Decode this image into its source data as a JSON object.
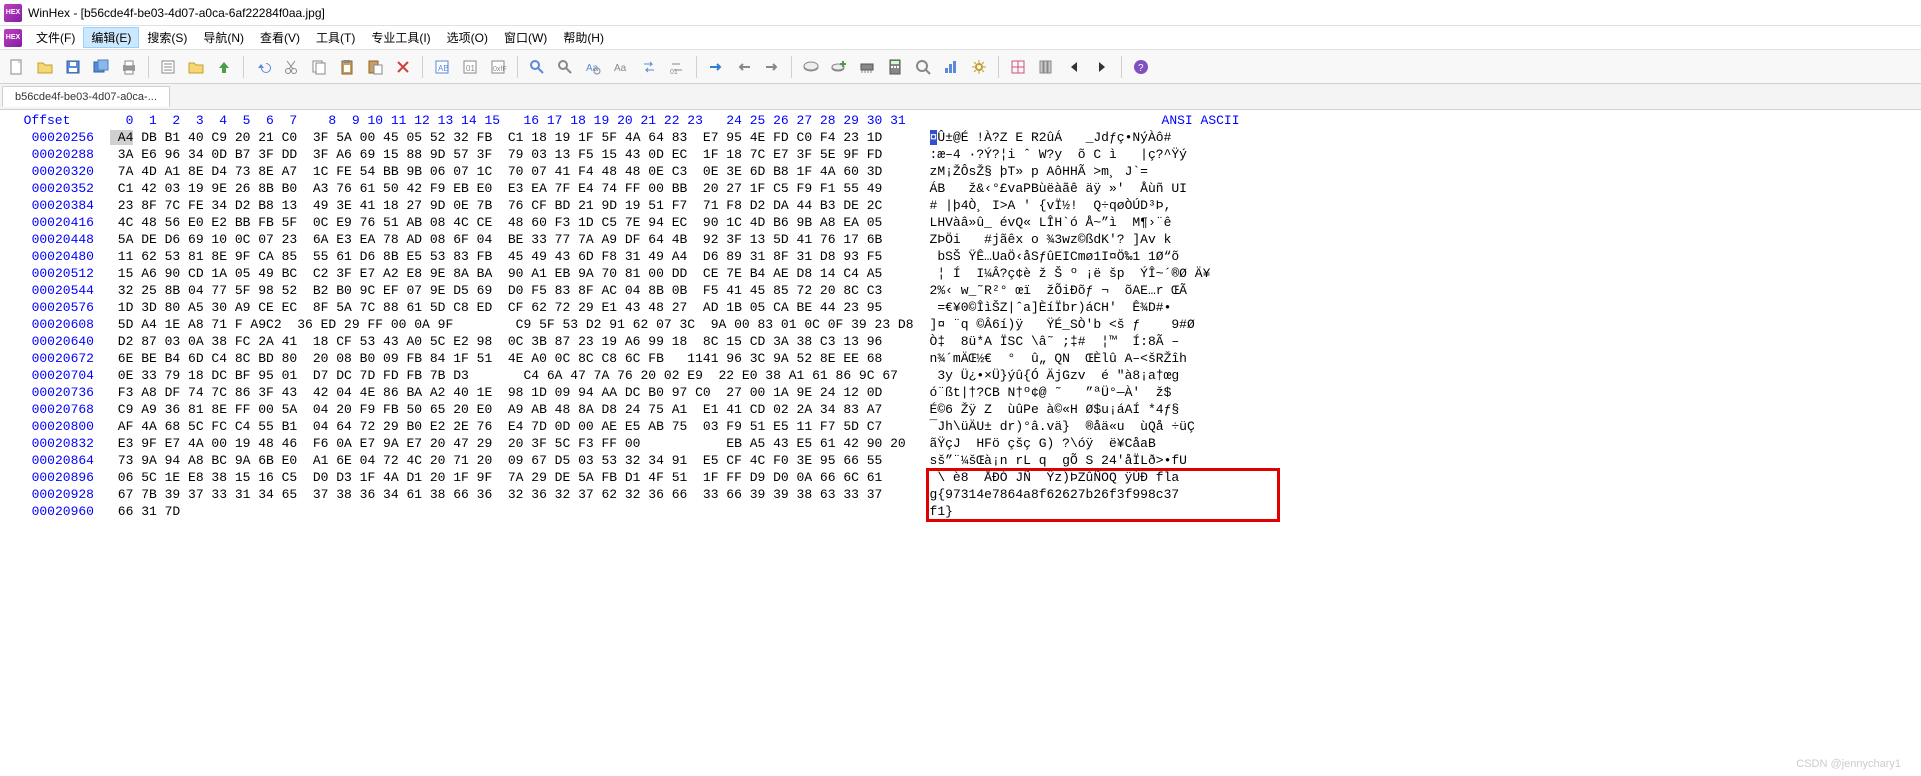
{
  "app": {
    "title": "WinHex - [b56cde4f-be03-4d07-a0ca-6af22284f0aa.jpg]",
    "icon_text": "HEX"
  },
  "menu": {
    "items": [
      {
        "label": "文件(F)"
      },
      {
        "label": "编辑(E)",
        "active": true
      },
      {
        "label": "搜索(S)"
      },
      {
        "label": "导航(N)"
      },
      {
        "label": "查看(V)"
      },
      {
        "label": "工具(T)"
      },
      {
        "label": "专业工具(I)"
      },
      {
        "label": "选项(O)"
      },
      {
        "label": "窗口(W)"
      },
      {
        "label": "帮助(H)"
      }
    ]
  },
  "tab": {
    "label": "b56cde4f-be03-4d07-a0ca-..."
  },
  "hex": {
    "offset_header": "Offset",
    "col_headers": [
      "0",
      "1",
      "2",
      "3",
      "4",
      "5",
      "6",
      "7",
      "8",
      "9",
      "10",
      "11",
      "12",
      "13",
      "14",
      "15",
      "16",
      "17",
      "18",
      "19",
      "20",
      "21",
      "22",
      "23",
      "24",
      "25",
      "26",
      "27",
      "28",
      "29",
      "30",
      "31"
    ],
    "ascii_header": "ANSI ASCII",
    "rows": [
      {
        "offset": "00020256",
        "bytes": "A4 DB B1 40 C9 20 21 C0  3F 5A 00 45 05 52 32 FB  C1 18 19 1F 5F 4A 64 83  E7 95 4E FD C0 F4 23 1D",
        "ascii": "¤Û±@É !À?Z E R2ûÁ   _Jdƒç•NýÀô#"
      },
      {
        "offset": "00020288",
        "bytes": "3A E6 96 34 0D B7 3F DD  3F A6 69 15 88 9D 57 3F  79 03 13 F5 15 43 0D EC  1F 18 7C E7 3F 5E 9F FD",
        "ascii": ":æ–4 ·?Ý?¦i ˆ W?y  õ C ì   |ç?^Ÿý"
      },
      {
        "offset": "00020320",
        "bytes": "7A 4D A1 8E D4 73 8E A7  1C FE 54 BB 9B 06 07 1C  70 07 41 F4 48 48 0E C3  0E 3E 6D B8 1F 4A 60 3D",
        "ascii": "zM¡ŽÔsŽ§ þT» p AôHHÃ >m¸ J`="
      },
      {
        "offset": "00020352",
        "bytes": "C1 42 03 19 9E 26 8B B0  A3 76 61 50 42 F9 EB E0  E3 EA 7F E4 74 FF 00 BB  20 27 1F C5 F9 F1 55 49",
        "ascii": "ÁB   ž&‹°£vaPBùëàãê äÿ »'  Åùñ UI"
      },
      {
        "offset": "00020384",
        "bytes": "23 8F 7C FE 34 D2 B8 13  49 3E 41 18 27 9D 0E 7B  76 CF BD 21 9D 19 51 F7  71 F8 D2 DA 44 B3 DE 2C",
        "ascii": "# |þ4Ò¸ I>A ' {vÏ½!  Q÷qøÒÚD³Þ,"
      },
      {
        "offset": "00020416",
        "bytes": "4C 48 56 E0 E2 BB FB 5F  0C E9 76 51 AB 08 4C CE  48 60 F3 1D C5 7E 94 EC  90 1C 4D B6 9B A8 EA 05",
        "ascii": "LHVàâ»û_ évQ« LÎH`ó Å~”ì  M¶›¨ê"
      },
      {
        "offset": "00020448",
        "bytes": "5A DE D6 69 10 0C 07 23  6A E3 EA 78 AD 08 6F 04  BE 33 77 7A A9 DF 64 4B  92 3F 13 5D 41 76 17 6B",
        "ascii": "ZÞÖi   #jãêx­ o ¾3wz©ßdK'? ]Av k"
      },
      {
        "offset": "00020480",
        "bytes": "11 62 53 81 8E 9F CA 85  55 61 D6 8B E5 53 83 FB  45 49 43 6D F8 31 49 A4  D6 89 31 8F 31 D8 93 F5",
        "ascii": " bSŠ ŸÊ…UaÖ‹åSƒûEICmø1I¤Ö‰1 1Ø“õ"
      },
      {
        "offset": "00020512",
        "bytes": "15 A6 90 CD 1A 05 49 BC  C2 3F E7 A2 E8 9E 8A BA  90 A1 EB 9A 70 81 00 DD  CE 7E B4 AE D8 14 C4 A5",
        "ascii": " ¦ Í  I¼Â?ç¢è ž Š º ¡ë šp  ÝÎ~´®Ø Ä¥"
      },
      {
        "offset": "00020544",
        "bytes": "32 25 8B 04 77 5F 98 52  B2 B0 9C EF 07 9E D5 69  D0 F5 83 8F AC 04 8B 0B  F5 41 45 85 72 20 8C C3",
        "ascii": "2%‹ w_˜R²° œï  žÕiÐõƒ ¬  õAE…r ŒÃ"
      },
      {
        "offset": "00020576",
        "bytes": "1D 3D 80 A5 30 A9 CE EC  8F 5A 7C 88 61 5D C8 ED  CF 62 72 29 E1 43 48 27  AD 1B 05 CA BE 44 23 95",
        "ascii": " =€¥0©ÎìŠZ|ˆa]ÈíÏbr)áCH'­  Ê¾D#•"
      },
      {
        "offset": "00020608",
        "bytes": "5D A4 1E A8 71 F A9C2  36 ED 29 FF 00 0A 9F        C9 5F 53 D2 91 62 07 3C  9A 00 83 01 0C 0F 39 23 D8",
        "ascii": "]¤ ¨q ©Â6í)ÿ   ŸÉ_SÒ'b <š ƒ    9#Ø"
      },
      {
        "offset": "00020640",
        "bytes": "D2 87 03 0A 38 FC 2A 41  18 CF 53 43 A0 5C E2 98  0C 3B 87 23 19 A6 99 18  8C 15 CD 3A 38 C3 13 96",
        "ascii": "Ò‡  8ü*A ÏSC \\â˜ ;‡#  ¦™  Í:8Ã –"
      },
      {
        "offset": "00020672",
        "bytes": "6E BE B4 6D C4 8C BD 80  20 08 B0 09 FB 84 1F 51  4E A0 0C 8C C8 6C FB   1141 96 3C 9A 52 8E EE 68",
        "ascii": "n¾´mÄŒ½€  °  û„ QN  ŒÈlû A–<šRŽîh"
      },
      {
        "offset": "00020704",
        "bytes": "0E 33 79 18 DC BF 95 01  D7 DC 7D FD FB 7B D3       C4 6A 47 7A 76 20 02 E9  22 E0 38 A1 61 86 9C 67",
        "ascii": " 3y Ü¿•×Ü}ýû{Ó ÄjGzv  é \"à8¡a†œg"
      },
      {
        "offset": "00020736",
        "bytes": "F3 A8 DF 74 7C 86 3F 43  42 04 4E 86 BA A2 40 1E  98 1D 09 94 AA DC B0 97 C0  27 00 1A 9E 24 12 0D",
        "ascii": "ó¨ßt|†?CB N†º¢@ ˜   ”ªÜ°—À'  ž$"
      },
      {
        "offset": "00020768",
        "bytes": "C9 A9 36 81 8E FF 00 5A  04 20 F9 FB 50 65 20 E0  A9 AB 48 8A D8 24 75 A1  E1 41 CD 02 2A 34 83 A7",
        "ascii": "É©6 Žÿ Z  ùûPe à©«H Ø$u¡áAÍ *4ƒ§"
      },
      {
        "offset": "00020800",
        "bytes": "AF 4A 68 5C FC C4 55 B1  04 64 72 29 B0 E2 2E 76  E4 7D 0D 00 AE E5 AB 75  03 F9 51 E5 11 F7 5D C7",
        "ascii": "¯Jh\\üÄU± dr)°â.vä}  ®åä«u  ùQå ÷üÇ"
      },
      {
        "offset": "00020832",
        "bytes": "E3 9F E7 4A 00 19 48 46  F6 0A E7 9A E7 20 47 29  20 3F 5C F3 FF 00           EB A5 43 E5 61 42 90 20",
        "ascii": "ãŸçJ  HFö çšç G) ?\\óÿ  ë¥CåaB  "
      },
      {
        "offset": "00020864",
        "bytes": "73 9A 94 A8 BC 9A 6B E0  A1 6E 04 72 4C 20 71 20  09 67 D5 03 53 32 34 91  E5 CF 4C F0 3E 95 66 55",
        "ascii": "sš”¨¼šŒà¡n rL q  gÕ S 24'åÏLð>•fU"
      },
      {
        "offset": "00020896",
        "bytes": "06 5C 1E E8 38 15 16 C5  D0 D3 1F 4A D1 20 1F 9F  7A 29 DE 5A FB D1 4F 51  1F FF D9 D0 0A 66 6C 61",
        "ascii": " \\ è8  ÅÐÓ JÑ  Ÿz)ÞZûÑOQ ÿÙÐ fla"
      },
      {
        "offset": "00020928",
        "bytes": "67 7B 39 37 33 31 34 65  37 38 36 34 61 38 66 36  32 36 32 37 62 32 36 66  33 66 39 39 38 63 33 37",
        "ascii": "g{97314e7864a8f62627b26f3f998c37"
      },
      {
        "offset": "00020960",
        "bytes": "66 31 7D",
        "ascii": "f1}"
      }
    ]
  },
  "watermark": "CSDN @jennychary1",
  "flag_box": {
    "top_row": 20,
    "bottom_row": 22
  }
}
